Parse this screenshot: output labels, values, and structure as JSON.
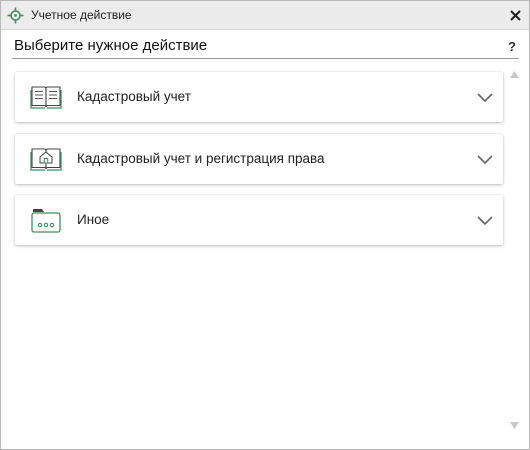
{
  "window": {
    "title": "Учетное действие"
  },
  "header": {
    "title": "Выберите нужное действие",
    "help_label": "?"
  },
  "actions": [
    {
      "label": "Кадастровый учет",
      "icon": "open-book-icon"
    },
    {
      "label": "Кадастровый учет и регистрация права",
      "icon": "book-house-icon"
    },
    {
      "label": "Иное",
      "icon": "folder-dots-icon"
    }
  ],
  "colors": {
    "accent": "#3f8f5e",
    "icon_stroke": "#3f8f5e"
  }
}
